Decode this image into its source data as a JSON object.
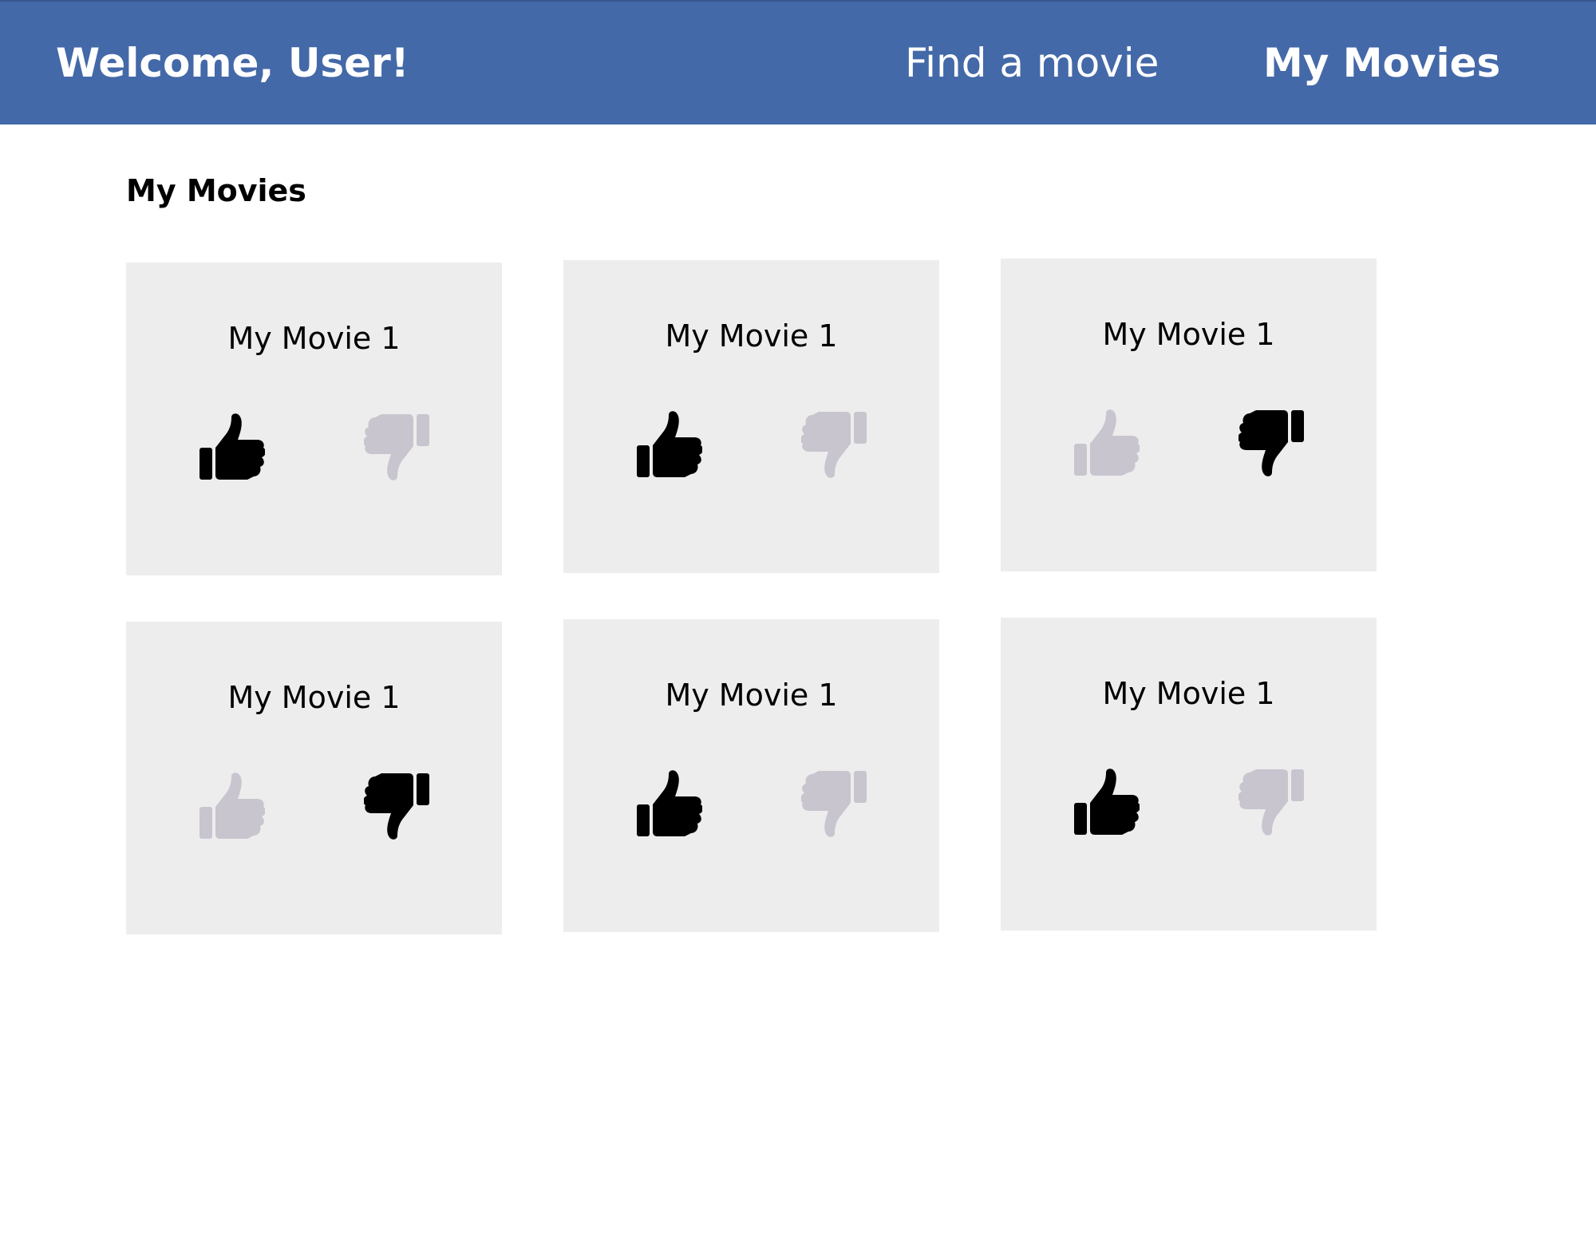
{
  "header": {
    "welcome": "Welcome, User!",
    "nav": {
      "find_movie": "Find a movie",
      "my_movies": "My Movies"
    }
  },
  "main": {
    "title": "My Movies",
    "movies": [
      {
        "title": "My Movie 1",
        "rating": "up"
      },
      {
        "title": "My Movie 1",
        "rating": "up"
      },
      {
        "title": "My Movie 1",
        "rating": "down"
      },
      {
        "title": "My Movie 1",
        "rating": "down"
      },
      {
        "title": "My Movie 1",
        "rating": "up"
      },
      {
        "title": "My Movie 1",
        "rating": "up"
      }
    ]
  },
  "colors": {
    "header_bg": "#4469a8",
    "card_bg": "#ededed",
    "icon_active": "#000000",
    "icon_inactive": "#c8c5cf"
  },
  "icons": {
    "up": "thumbs-up-icon",
    "down": "thumbs-down-icon"
  }
}
